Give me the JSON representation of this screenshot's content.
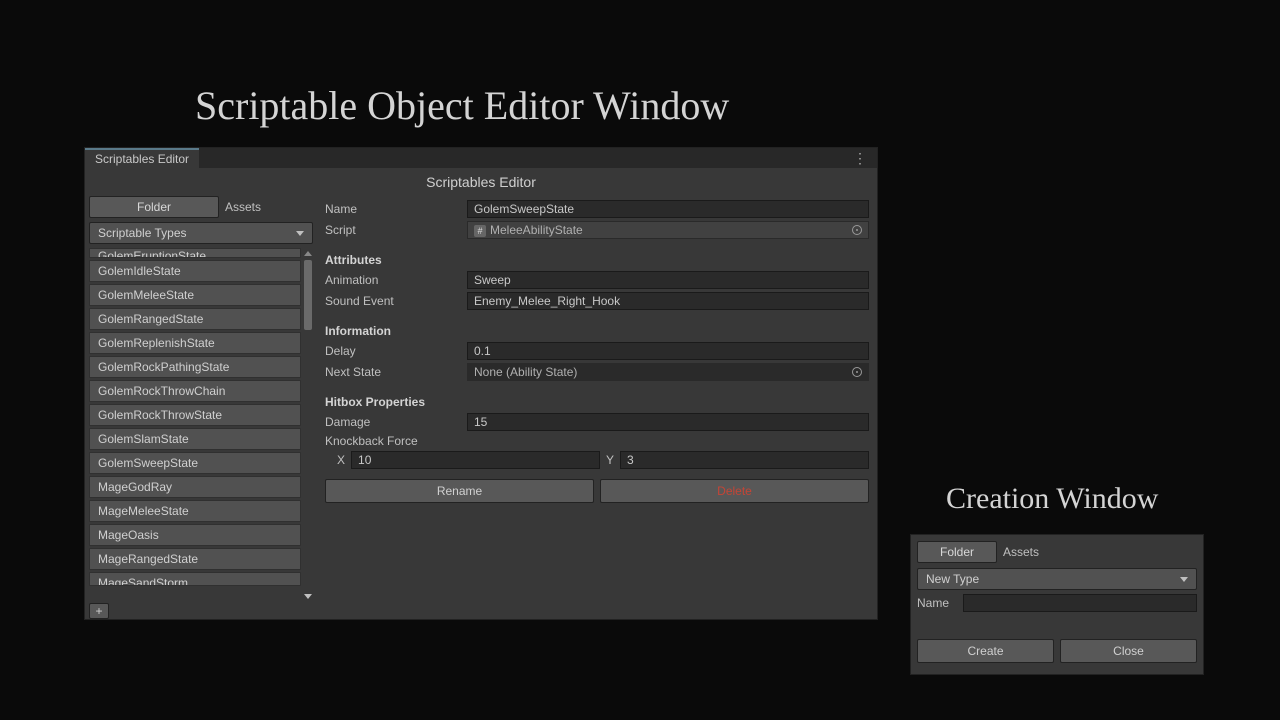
{
  "main_title": "Scriptable Object Editor Window",
  "editor": {
    "tab": "Scriptables Editor",
    "header": "Scriptables Editor",
    "folder_btn": "Folder",
    "assets_label": "Assets",
    "types_dropdown": "Scriptable Types",
    "list": [
      "GolemEruptionState",
      "GolemIdleState",
      "GolemMeleeState",
      "GolemRangedState",
      "GolemReplenishState",
      "GolemRockPathingState",
      "GolemRockThrowChain",
      "GolemRockThrowState",
      "GolemSlamState",
      "GolemSweepState",
      "MageGodRay",
      "MageMeleeState",
      "MageOasis",
      "MageRangedState",
      "MageSandStorm"
    ],
    "plus": "+",
    "name_label": "Name",
    "name_value": "GolemSweepState",
    "script_label": "Script",
    "script_value": "MeleeAbilityState",
    "attributes_head": "Attributes",
    "animation_label": "Animation",
    "animation_value": "Sweep",
    "sound_label": "Sound Event",
    "sound_value": "Enemy_Melee_Right_Hook",
    "information_head": "Information",
    "delay_label": "Delay",
    "delay_value": "0.1",
    "nextstate_label": "Next State",
    "nextstate_value": "None (Ability State)",
    "hitbox_head": "Hitbox Properties",
    "damage_label": "Damage",
    "damage_value": "15",
    "knockback_label": "Knockback Force",
    "x_label": "X",
    "x_value": "10",
    "y_label": "Y",
    "y_value": "3",
    "rename_btn": "Rename",
    "delete_btn": "Delete"
  },
  "creation": {
    "title": "Creation Window",
    "folder_btn": "Folder",
    "assets_label": "Assets",
    "type_dropdown": "New Type",
    "name_label": "Name",
    "name_value": "",
    "create_btn": "Create",
    "close_btn": "Close"
  }
}
